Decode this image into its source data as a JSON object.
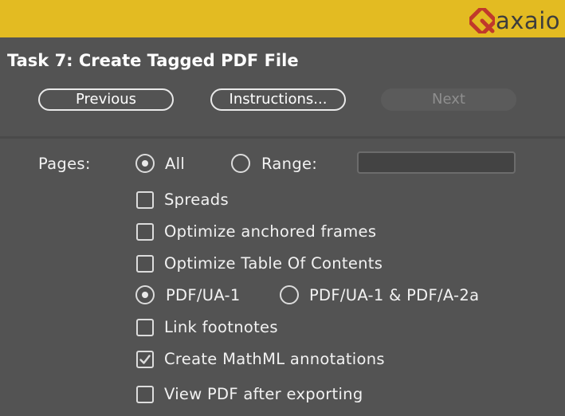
{
  "brand": {
    "name": "axaio",
    "icon": "axaio-logo-icon",
    "header_color": "#e3bb22"
  },
  "title": "Task 7: Create Tagged PDF File",
  "buttons": {
    "previous": "Previous",
    "instructions": "Instructions...",
    "next": "Next"
  },
  "pages": {
    "label": "Pages:",
    "options": [
      {
        "label": "All",
        "selected": true
      },
      {
        "label": "Range:",
        "selected": false
      }
    ],
    "range_value": ""
  },
  "options": {
    "spreads": {
      "label": "Spreads",
      "checked": false
    },
    "optimize_anchored": {
      "label": "Optimize anchored frames",
      "checked": false
    },
    "optimize_toc": {
      "label": "Optimize Table Of Contents",
      "checked": false
    },
    "standard": [
      {
        "label": "PDF/UA-1",
        "selected": true
      },
      {
        "label": "PDF/UA-1 & PDF/A-2a",
        "selected": false
      }
    ],
    "link_footnotes": {
      "label": "Link footnotes",
      "checked": false
    },
    "mathml": {
      "label": "Create MathML annotations",
      "checked": true
    },
    "view_pdf": {
      "label": "View PDF after exporting",
      "checked": false
    }
  }
}
